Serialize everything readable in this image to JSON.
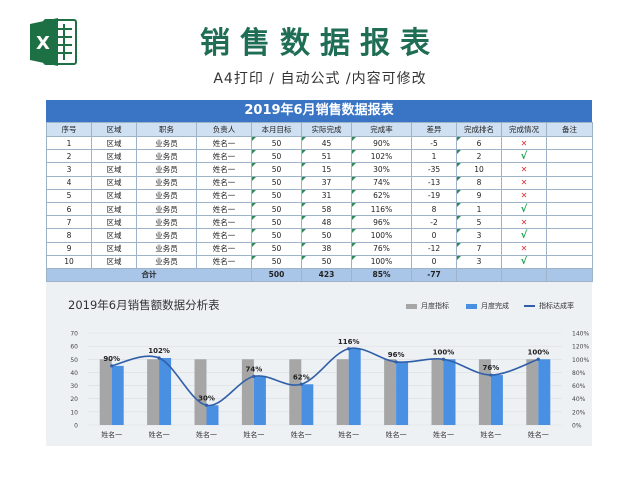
{
  "header": {
    "title": "销售数据报表",
    "subtitle": "A4打印 / 自动公式 /内容可修改"
  },
  "table": {
    "title": "2019年6月销售数据报表",
    "columns": [
      "序号",
      "区域",
      "职务",
      "负责人",
      "本月目标",
      "实际完成",
      "完成率",
      "差异",
      "完成排名",
      "完成情况",
      "备注"
    ],
    "rows": [
      [
        "1",
        "区域",
        "业务员",
        "姓名一",
        "50",
        "45",
        "90%",
        "-5",
        "6",
        "✕",
        ""
      ],
      [
        "2",
        "区域",
        "业务员",
        "姓名一",
        "50",
        "51",
        "102%",
        "1",
        "2",
        "√",
        ""
      ],
      [
        "3",
        "区域",
        "业务员",
        "姓名一",
        "50",
        "15",
        "30%",
        "-35",
        "10",
        "✕",
        ""
      ],
      [
        "4",
        "区域",
        "业务员",
        "姓名一",
        "50",
        "37",
        "74%",
        "-13",
        "8",
        "✕",
        ""
      ],
      [
        "5",
        "区域",
        "业务员",
        "姓名一",
        "50",
        "31",
        "62%",
        "-19",
        "9",
        "✕",
        ""
      ],
      [
        "6",
        "区域",
        "业务员",
        "姓名一",
        "50",
        "58",
        "116%",
        "8",
        "1",
        "√",
        ""
      ],
      [
        "7",
        "区域",
        "业务员",
        "姓名一",
        "50",
        "48",
        "96%",
        "-2",
        "5",
        "✕",
        ""
      ],
      [
        "8",
        "区域",
        "业务员",
        "姓名一",
        "50",
        "50",
        "100%",
        "0",
        "3",
        "√",
        ""
      ],
      [
        "9",
        "区域",
        "业务员",
        "姓名一",
        "50",
        "38",
        "76%",
        "-12",
        "7",
        "✕",
        ""
      ],
      [
        "10",
        "区域",
        "业务员",
        "姓名一",
        "50",
        "50",
        "100%",
        "0",
        "3",
        "√",
        ""
      ]
    ],
    "total": {
      "label": "合计",
      "target": "500",
      "actual": "423",
      "rate": "85%",
      "diff": "-77"
    }
  },
  "chart_data": {
    "type": "bar",
    "title": "2019年6月销售额数据分析表",
    "categories": [
      "姓名一",
      "姓名一",
      "姓名一",
      "姓名一",
      "姓名一",
      "姓名一",
      "姓名一",
      "姓名一",
      "姓名一",
      "姓名一"
    ],
    "series": [
      {
        "name": "月度指标",
        "type": "bar",
        "axis": "left",
        "color": "#a6a6a6",
        "values": [
          50,
          50,
          50,
          50,
          50,
          50,
          50,
          50,
          50,
          50
        ]
      },
      {
        "name": "月度完成",
        "type": "bar",
        "axis": "left",
        "color": "#4a90e2",
        "values": [
          45,
          51,
          15,
          37,
          31,
          58,
          48,
          50,
          38,
          50
        ]
      },
      {
        "name": "指标达成率",
        "type": "line",
        "axis": "right",
        "color": "#2f5fa8",
        "values": [
          90,
          102,
          30,
          74,
          62,
          116,
          96,
          100,
          76,
          100
        ],
        "labels": [
          "90%",
          "102%",
          "30%",
          "74%",
          "62%",
          "116%",
          "96%",
          "100%",
          "76%",
          "100%"
        ]
      }
    ],
    "ylim_left": [
      0,
      70
    ],
    "yticks_left": [
      "0",
      "10",
      "20",
      "30",
      "40",
      "50",
      "60",
      "70"
    ],
    "ylim_right": [
      0,
      140
    ],
    "yticks_right": [
      "0%",
      "20%",
      "40%",
      "60%",
      "80%",
      "100%",
      "120%",
      "140%"
    ],
    "legend_position": "top-right",
    "grid": true
  }
}
